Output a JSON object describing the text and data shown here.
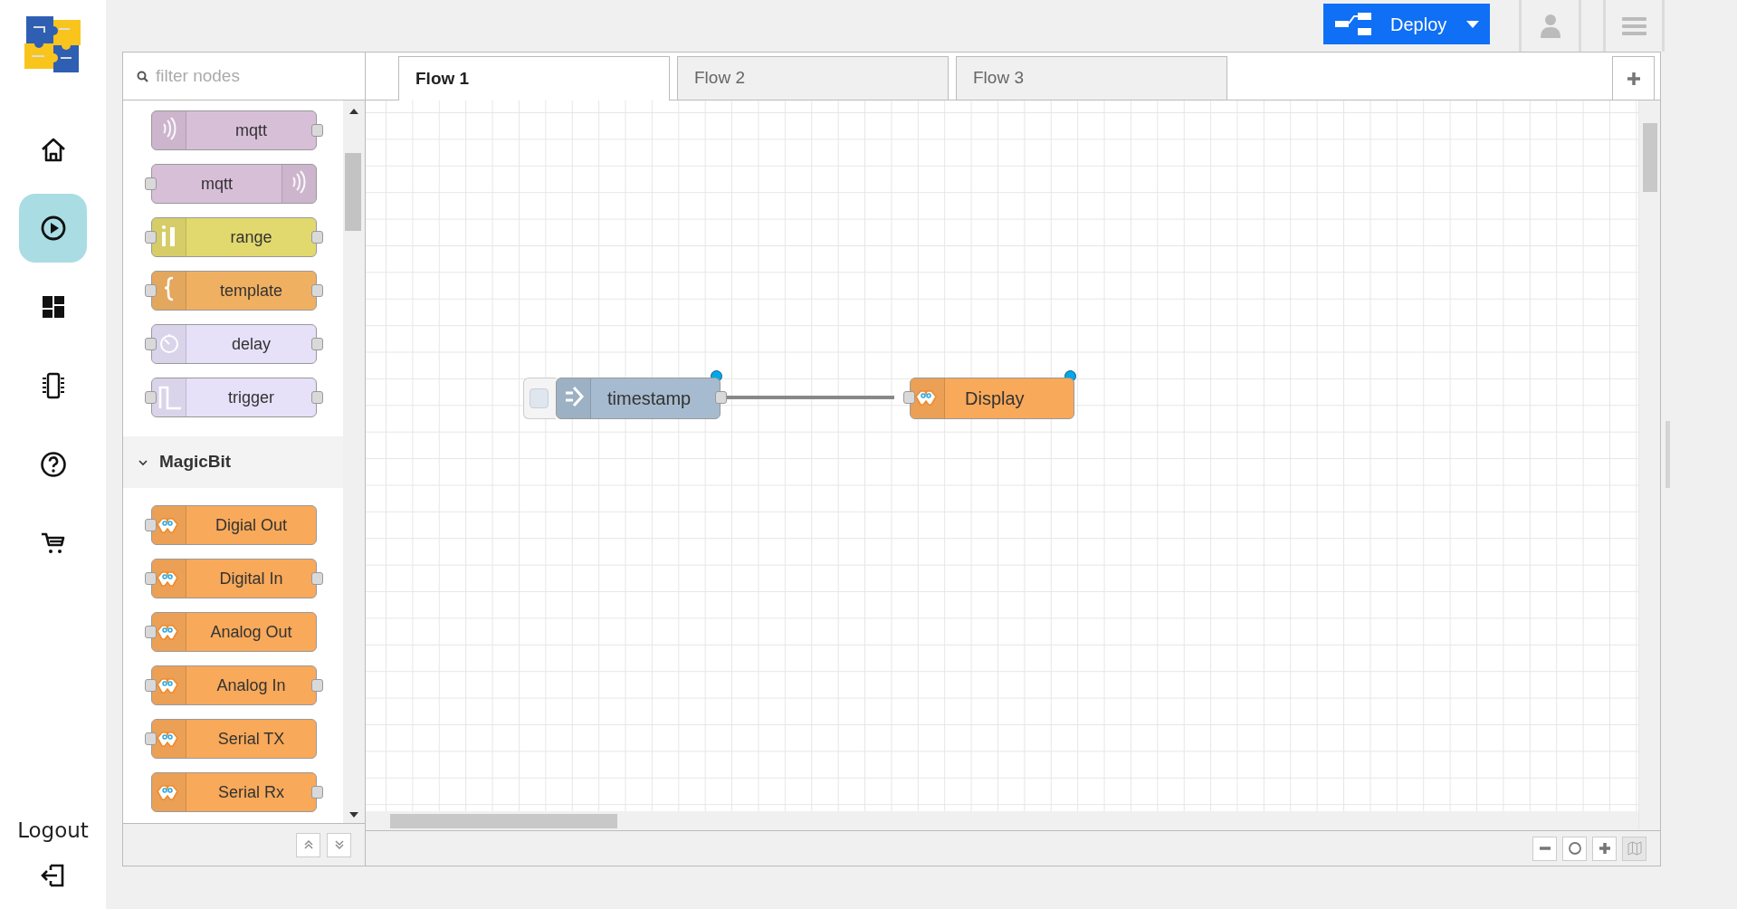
{
  "nav": {
    "items": [
      {
        "kind": "home",
        "selected": false
      },
      {
        "kind": "play",
        "selected": true
      },
      {
        "kind": "dashboard",
        "selected": false
      },
      {
        "kind": "chip",
        "selected": false
      },
      {
        "kind": "help",
        "selected": false
      },
      {
        "kind": "cart",
        "selected": false
      }
    ],
    "logout": "Logout"
  },
  "header": {
    "deploy": "Deploy"
  },
  "palette": {
    "search": {
      "placeholder": "filter nodes"
    },
    "sections": [
      {
        "nodes": [
          {
            "label": "mqtt",
            "color": "#d8bfd8",
            "kind": "mqttin",
            "input": false,
            "output": true
          },
          {
            "label": "mqtt",
            "color": "#d8bfd8",
            "kind": "mqttout",
            "input": true,
            "output": false
          },
          {
            "label": "range",
            "color": "#e2d96e",
            "kind": "range",
            "input": true,
            "output": true
          },
          {
            "label": "template",
            "color": "#f0b062",
            "kind": "template",
            "input": true,
            "output": true
          },
          {
            "label": "delay",
            "color": "#e6e0f8",
            "kind": "delay",
            "input": true,
            "output": true
          },
          {
            "label": "trigger",
            "color": "#e6e0f8",
            "kind": "trigger",
            "input": true,
            "output": true
          }
        ]
      },
      {
        "title": "MagicBit",
        "expanded": true,
        "nodes": [
          {
            "label": "Digial Out",
            "color": "#f8a95a",
            "kind": "magicbit",
            "input": true,
            "output": false
          },
          {
            "label": "Digital In",
            "color": "#f8a95a",
            "kind": "magicbit",
            "input": true,
            "output": true
          },
          {
            "label": "Analog Out",
            "color": "#f8a95a",
            "kind": "magicbit",
            "input": true,
            "output": false
          },
          {
            "label": "Analog In",
            "color": "#f8a95a",
            "kind": "magicbit",
            "input": true,
            "output": true
          },
          {
            "label": "Serial TX",
            "color": "#f8a95a",
            "kind": "magicbit",
            "input": true,
            "output": false
          },
          {
            "label": "Serial Rx",
            "color": "#f8a95a",
            "kind": "magicbit",
            "input": false,
            "output": true
          }
        ]
      }
    ]
  },
  "tabs": [
    {
      "label": "Flow 1",
      "selected": true
    },
    {
      "label": "Flow 2",
      "selected": false
    },
    {
      "label": "Flow 3",
      "selected": false
    }
  ],
  "flow": {
    "nodes": [
      {
        "label": "timestamp",
        "kind": "inject",
        "color": "#a6bbcf",
        "changed": true,
        "input": false,
        "output": true
      },
      {
        "label": "Display",
        "kind": "magicbit",
        "color": "#f8a95a",
        "changed": true,
        "input": true,
        "output": false
      }
    ]
  }
}
